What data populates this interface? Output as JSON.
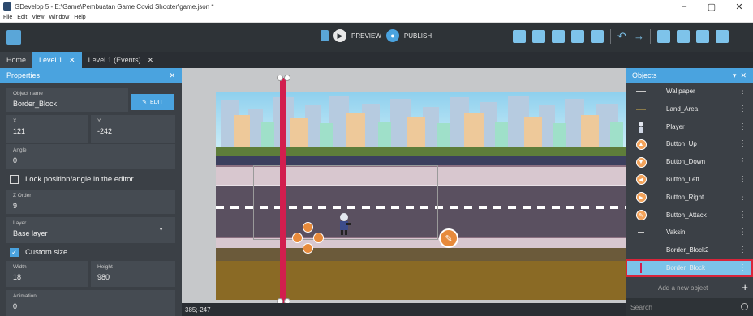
{
  "window": {
    "title": "GDevelop 5 - E:\\Game\\Pembuatan Game Covid Shooter\\game.json *",
    "controls": [
      "–",
      "▢",
      "✕"
    ]
  },
  "menu": [
    "File",
    "Edit",
    "View",
    "Window",
    "Help"
  ],
  "toolbar": {
    "preview_label": "PREVIEW",
    "publish_label": "PUBLISH"
  },
  "tabs": [
    {
      "label": "Home"
    },
    {
      "label": "Level 1",
      "close": "✕"
    },
    {
      "label": "Level 1 (Events)",
      "close": "✕"
    }
  ],
  "properties": {
    "title": "Properties",
    "close": "✕",
    "object_name_label": "Object name",
    "object_name_value": "Border_Block",
    "edit_label": "EDIT",
    "x_label": "X",
    "x_value": "121",
    "y_label": "Y",
    "y_value": "-242",
    "angle_label": "Angle",
    "angle_value": "0",
    "lock_label": "Lock position/angle in the editor",
    "z_order_label": "Z Order",
    "z_order_value": "9",
    "layer_label": "Layer",
    "layer_value": "Base layer",
    "custom_size_label": "Custom size",
    "width_label": "Width",
    "width_value": "18",
    "height_label": "Height",
    "height_value": "980",
    "animation_label": "Animation",
    "animation_value": "0"
  },
  "canvas": {
    "cursor_coords": "385;-247"
  },
  "objects": {
    "title": "Objects",
    "items": [
      {
        "name": "Wallpaper",
        "icon": "line-icon"
      },
      {
        "name": "Land_Area",
        "icon": "line-icon"
      },
      {
        "name": "Player",
        "icon": "player-icon"
      },
      {
        "name": "Button_Up",
        "icon": "button-up-icon"
      },
      {
        "name": "Button_Down",
        "icon": "button-down-icon"
      },
      {
        "name": "Button_Left",
        "icon": "button-left-icon"
      },
      {
        "name": "Button_Right",
        "icon": "button-right-icon"
      },
      {
        "name": "Button_Attack",
        "icon": "attack-icon"
      },
      {
        "name": "Vaksin",
        "icon": "line-icon"
      },
      {
        "name": "Border_Block2",
        "icon": "blank"
      },
      {
        "name": "Border_Block",
        "icon": "red-bar-icon"
      }
    ],
    "selected_index": 10,
    "add_label": "Add a new object",
    "search_placeholder": "Search"
  },
  "colors": {
    "accent": "#4aa3df",
    "border_block": "#d21e4e",
    "selected_row": "#7cc3ea"
  }
}
